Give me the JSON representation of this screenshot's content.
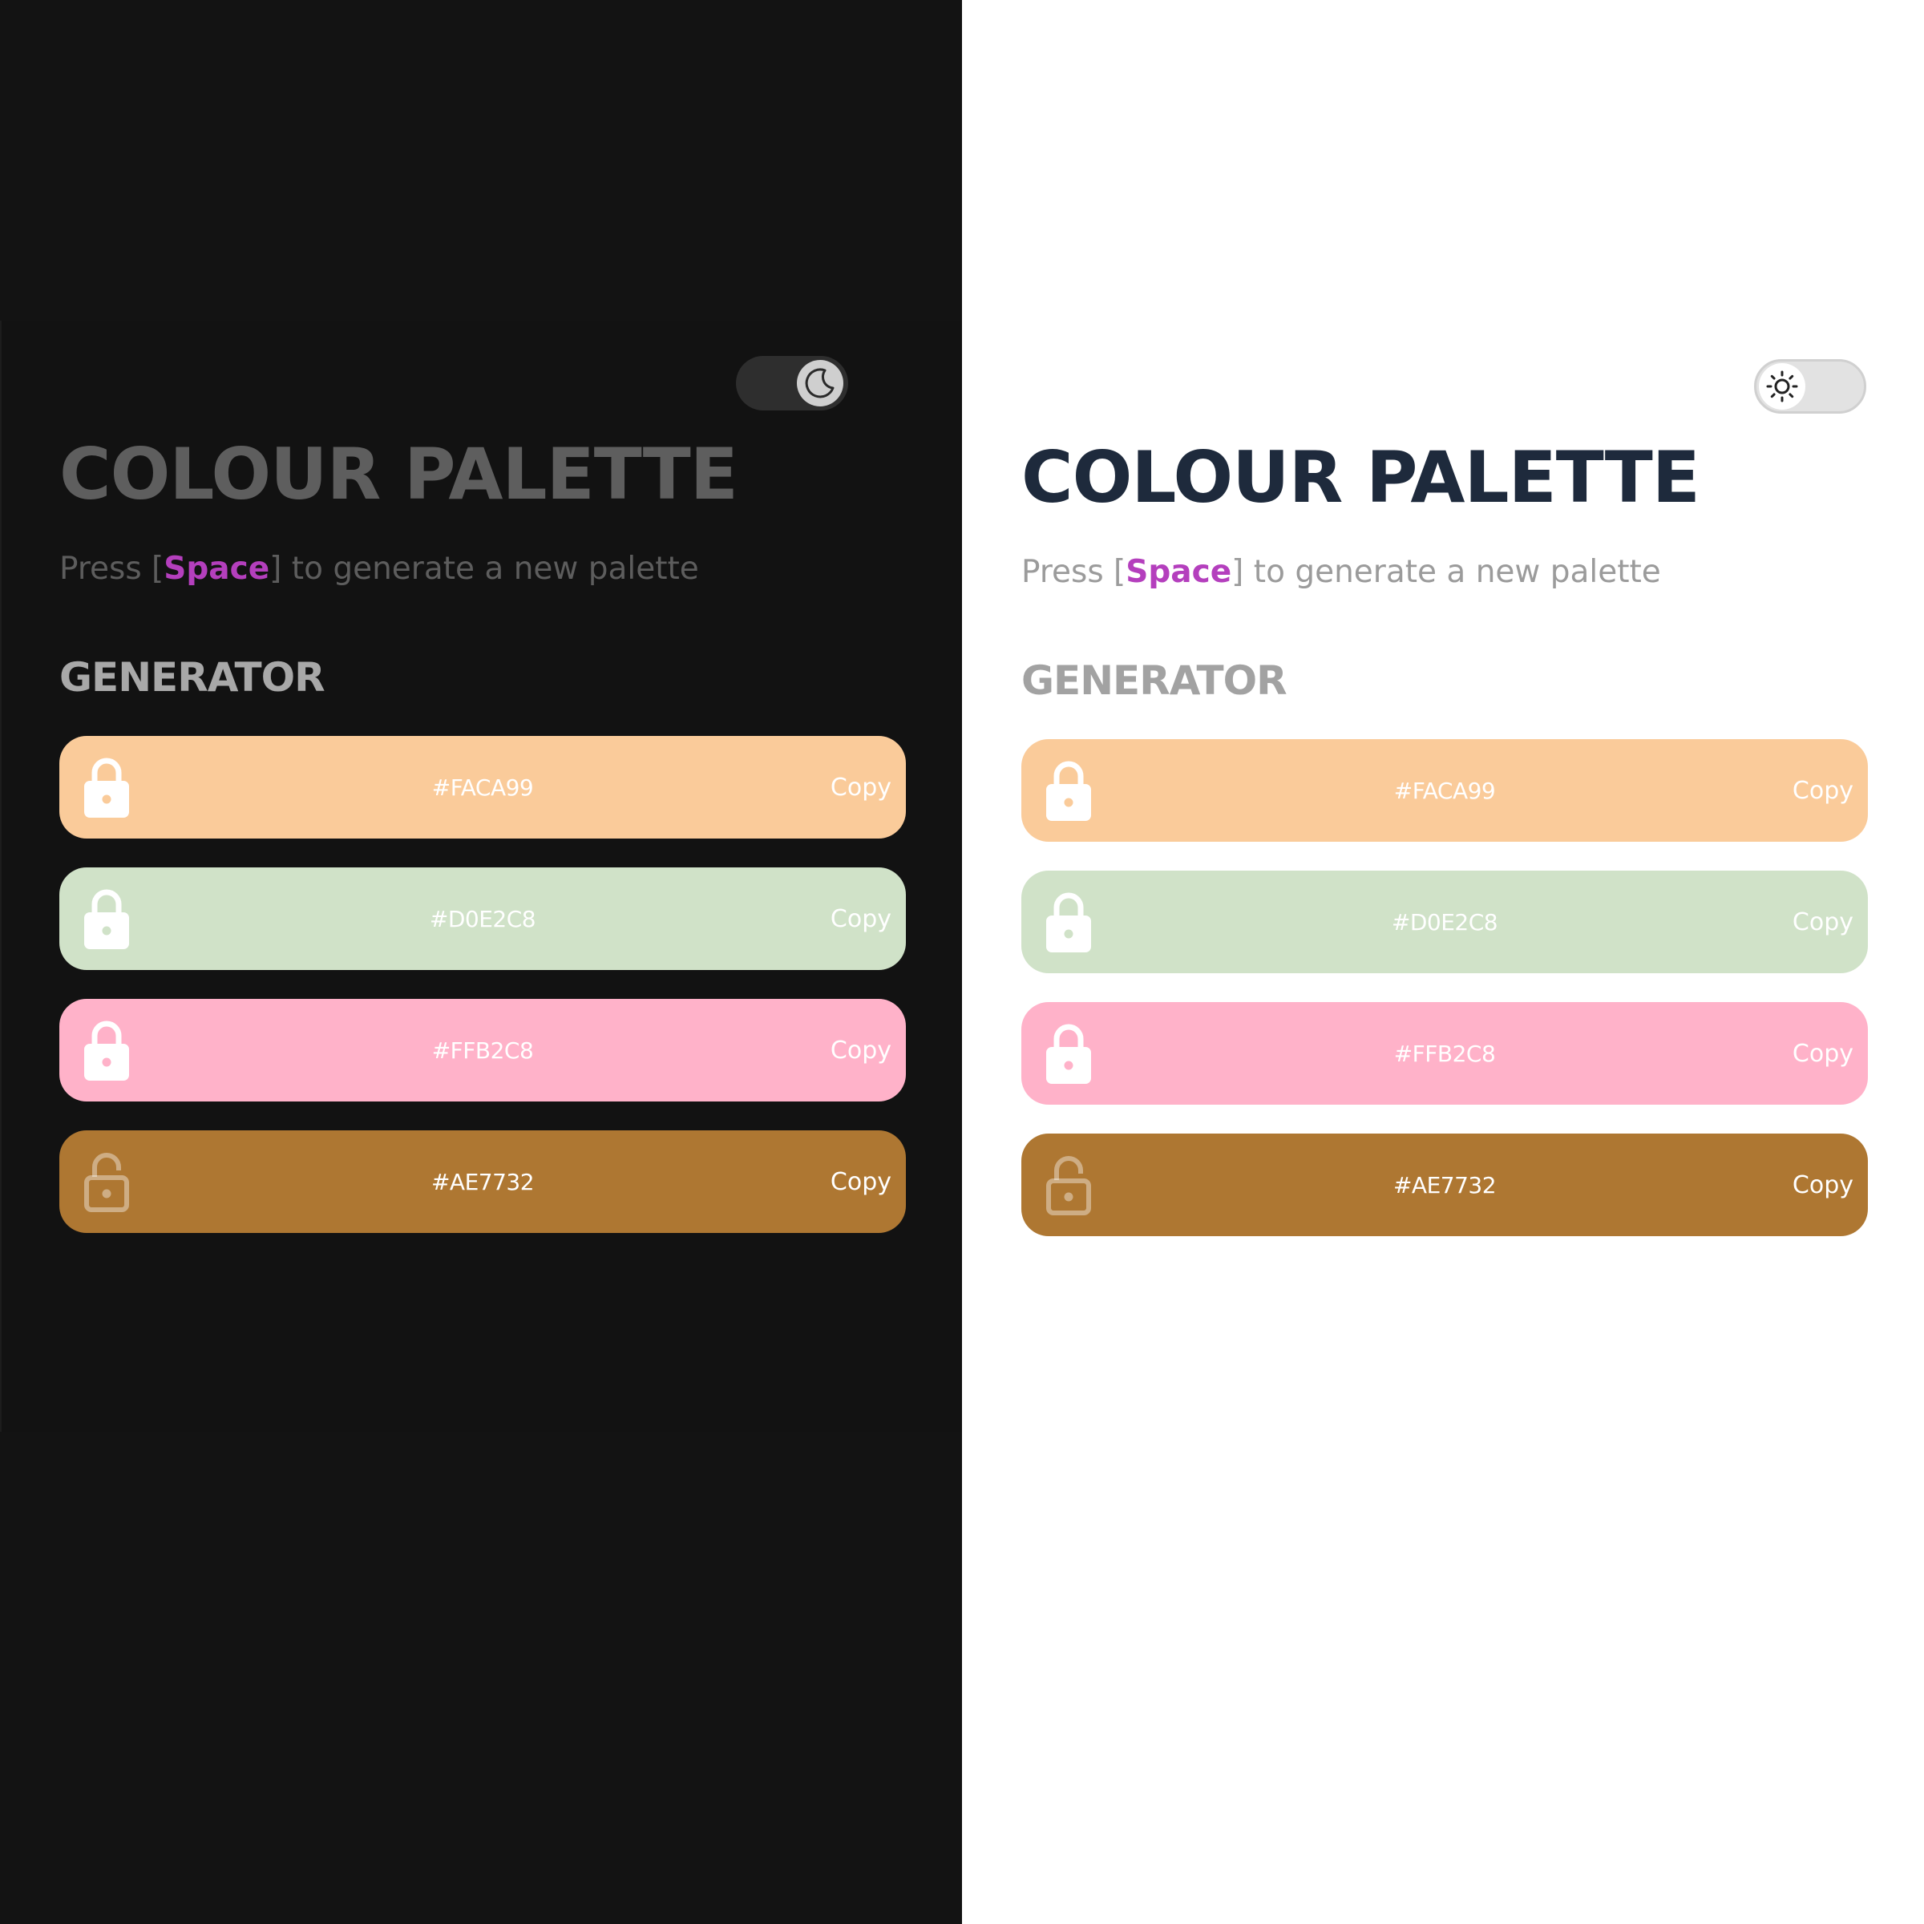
{
  "title": "COLOUR PALETTE",
  "subtitle": {
    "before": "Press [",
    "key": "Space",
    "after": "] to generate a new palette"
  },
  "section_heading": "GENERATOR",
  "copy_label": "Copy",
  "dark_toggle": {
    "icon": "moon-icon",
    "mode": "dark"
  },
  "light_toggle": {
    "icon": "sun-icon",
    "mode": "light"
  },
  "palette": [
    {
      "hex": "#FACA99",
      "color": "#facb9a",
      "locked": true
    },
    {
      "hex": "#D0E2C8",
      "color": "#d0e2c8",
      "locked": true
    },
    {
      "hex": "#FFB2C8",
      "color": "#ffb2c9",
      "locked": true
    },
    {
      "hex": "#AE7732",
      "color": "#ae7732",
      "locked": false
    }
  ],
  "colors": {
    "accent_key": "#b43fbd",
    "dark_bg": "#131313",
    "light_bg": "#ffffff",
    "light_title": "#1e2a3c"
  }
}
